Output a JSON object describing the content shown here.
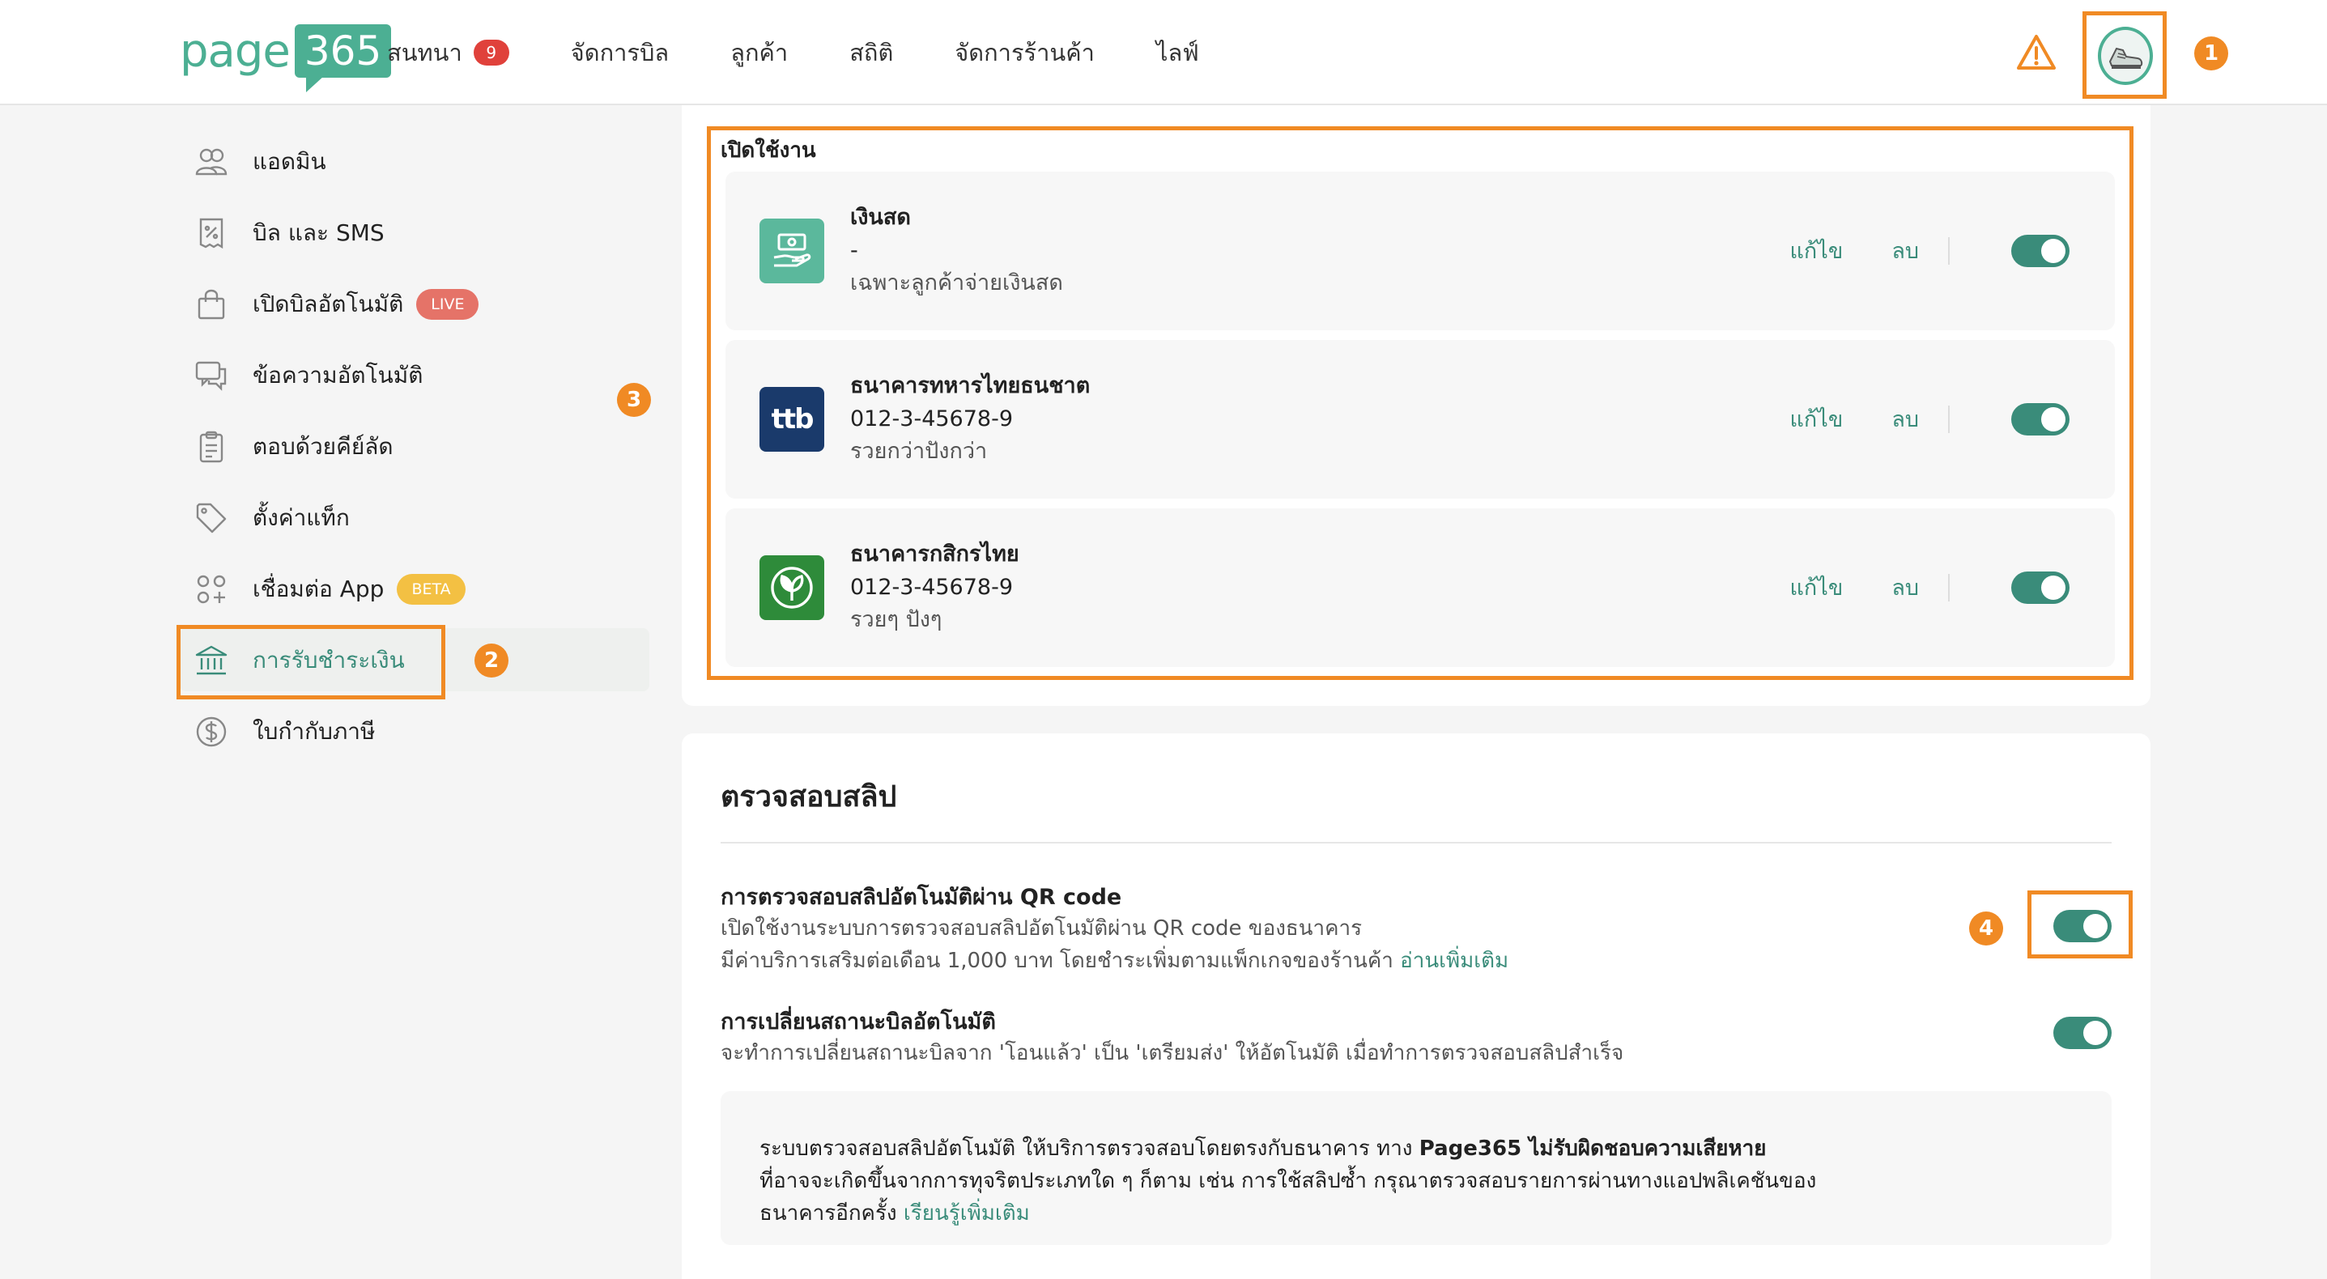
{
  "header": {
    "logo_word": "page",
    "logo_num": "365",
    "nav": [
      {
        "label": "สนทนา",
        "badge": "9"
      },
      {
        "label": "จัดการบิล"
      },
      {
        "label": "ลูกค้า"
      },
      {
        "label": "สถิติ"
      },
      {
        "label": "จัดการร้านค้า"
      },
      {
        "label": "ไลฟ์"
      }
    ],
    "icons": {
      "warning": "warning-triangle-icon",
      "avatar": "sneaker-avatar"
    }
  },
  "markers": [
    "1",
    "2",
    "3",
    "4"
  ],
  "sidebar": {
    "items": [
      {
        "label": "แอดมิน",
        "icon": "admin-users-icon"
      },
      {
        "label": "บิล และ SMS",
        "icon": "receipt-icon"
      },
      {
        "label": "เปิดบิลอัตโนมัติ",
        "icon": "shopping-bag-icon",
        "tag": "LIVE"
      },
      {
        "label": "ข้อความอัตโนมัติ",
        "icon": "chat-bubble-icon"
      },
      {
        "label": "ตอบด้วยคีย์ลัด",
        "icon": "clipboard-icon"
      },
      {
        "label": "ตั้งค่าแท็ก",
        "icon": "tag-icon"
      },
      {
        "label": "เชื่อมต่อ App",
        "icon": "apps-grid-icon",
        "tag": "BETA"
      },
      {
        "label": "การรับชำระเงิน",
        "icon": "bank-icon",
        "active": true
      },
      {
        "label": "ใบกำกับภาษี",
        "icon": "dollar-circle-icon"
      }
    ]
  },
  "payments": {
    "section_title": "เปิดใช้งาน",
    "edit_label": "แก้ไข",
    "delete_label": "ลบ",
    "items": [
      {
        "name": "เงินสด",
        "account": "-",
        "note": "เฉพาะลูกค้าจ่ายเงินสด",
        "icon": "cash-hand-icon",
        "color": "#5bb89c",
        "enabled": true
      },
      {
        "name": "ธนาคารทหารไทยธนชาต",
        "account": "012-3-45678-9",
        "note": "รวยกว่าปังกว่า",
        "icon": "ttb-logo",
        "logo_text": "ttb",
        "color": "#1a3a6b",
        "enabled": true
      },
      {
        "name": "ธนาคารกสิกรไทย",
        "account": "012-3-45678-9",
        "note": "รวยๆ ปังๆ",
        "icon": "kbank-leaf-logo",
        "color": "#2e8b3a",
        "enabled": true
      }
    ]
  },
  "slip": {
    "title": "ตรวจสอบสลิป",
    "settings": [
      {
        "title": "การตรวจสอบสลิปอัตโนมัติผ่าน QR code",
        "desc1": "เปิดใช้งานระบบการตรวจสอบสลิปอัตโนมัติผ่าน QR code ของธนาคาร",
        "desc2": "มีค่าบริการเสริมต่อเดือน 1,000 บาท โดยชำระเพิ่มตามแพ็กเกจของร้านค้า",
        "link": "อ่านเพิ่มเติม",
        "enabled": true
      },
      {
        "title": "การเปลี่ยนสถานะบิลอัตโนมัติ",
        "desc1": "จะทำการเปลี่ยนสถานะบิลจาก 'โอนแล้ว' เป็น 'เตรียมส่ง' ให้อัตโนมัติ เมื่อทำการตรวจสอบสลิปสำเร็จ",
        "enabled": true
      }
    ],
    "info": {
      "line1_prefix": "ระบบตรวจสอบสลิปอัตโนมัติ ให้บริการตรวจสอบโดยตรงกับธนาคาร ทาง",
      "line1_bold": "Page365 ไม่รับผิดชอบความเสียหาย",
      "line2": "ที่อาจจะเกิดขึ้นจากการทุจริตประเภทใด ๆ ก็ตาม เช่น การใช้สลิปซ้ำ กรุณาตรวจสอบรายการผ่านทางแอปพลิเคชันของ",
      "line3_prefix": "ธนาคารอีกครั้ง",
      "line3_link": "เรียนรู้เพิ่มเติม"
    }
  },
  "colors": {
    "accent": "#3a8c7a",
    "brand": "#4caf93",
    "highlight": "#f08a24",
    "badge": "#e0413b"
  }
}
